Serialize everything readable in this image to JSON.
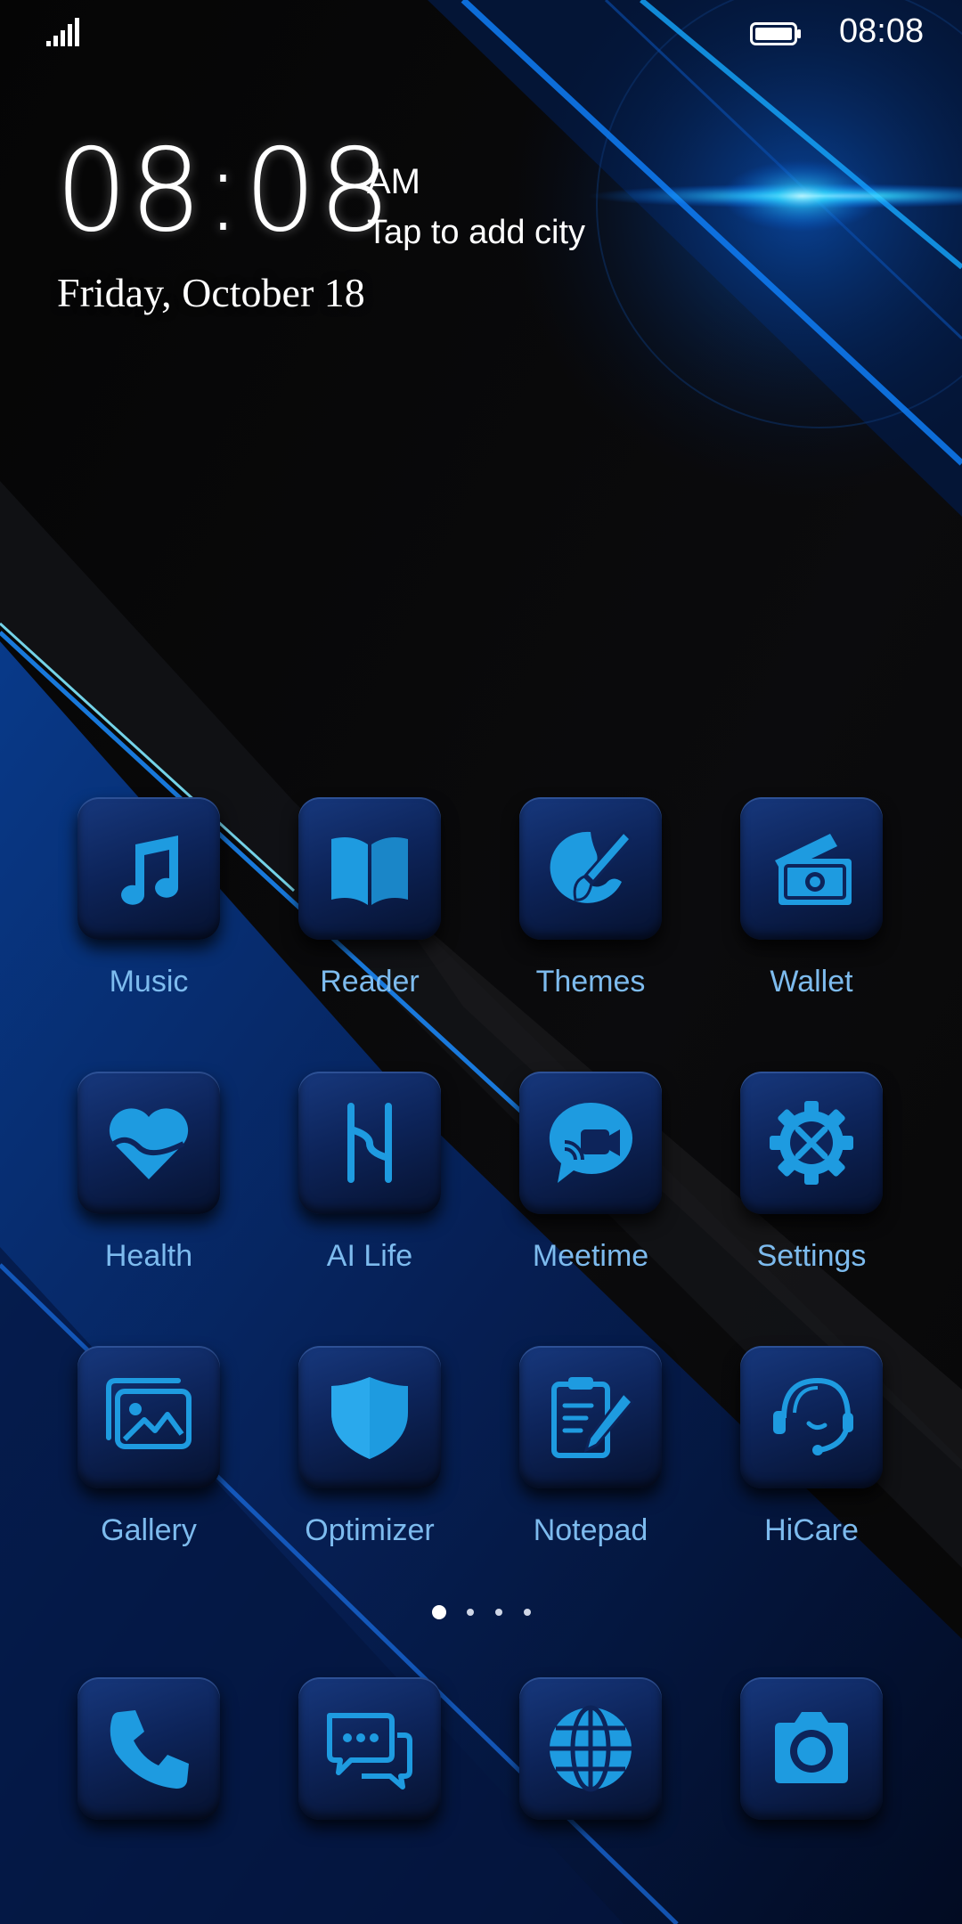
{
  "status_bar": {
    "time": "08:08"
  },
  "clock": {
    "time": "08:08",
    "ampm": "AM",
    "city_prompt": "Tap to add city",
    "date": "Friday, October 18"
  },
  "apps": [
    {
      "label": "Music",
      "icon": "music-icon"
    },
    {
      "label": "Reader",
      "icon": "book-icon"
    },
    {
      "label": "Themes",
      "icon": "paintbrush-icon"
    },
    {
      "label": "Wallet",
      "icon": "wallet-icon"
    },
    {
      "label": "Health",
      "icon": "heart-icon"
    },
    {
      "label": "AI Life",
      "icon": "ai-life-icon"
    },
    {
      "label": "Meetime",
      "icon": "video-chat-icon"
    },
    {
      "label": "Settings",
      "icon": "gear-icon"
    },
    {
      "label": "Gallery",
      "icon": "gallery-icon"
    },
    {
      "label": "Optimizer",
      "icon": "shield-icon"
    },
    {
      "label": "Notepad",
      "icon": "notepad-icon"
    },
    {
      "label": "HiCare",
      "icon": "headset-icon"
    }
  ],
  "page_indicator": {
    "pages": 4,
    "active": 1
  },
  "dock": [
    {
      "icon": "phone-icon"
    },
    {
      "icon": "messages-icon"
    },
    {
      "icon": "browser-globe-icon"
    },
    {
      "icon": "camera-icon"
    }
  ],
  "colors": {
    "icon_blue": "#1e9be0",
    "label_blue": "#7dbbee",
    "tile_blue": "#0d245a"
  }
}
